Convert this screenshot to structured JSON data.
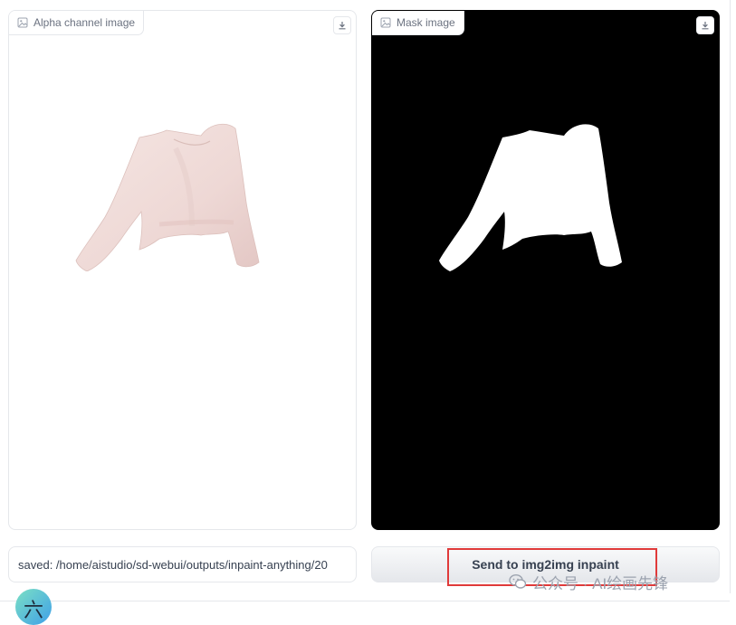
{
  "left_panel": {
    "label": "Alpha channel image",
    "icon": "image-icon",
    "download_icon": "download-icon"
  },
  "right_panel": {
    "label": "Mask image",
    "icon": "image-icon",
    "download_icon": "download-icon"
  },
  "status": {
    "text": "saved: /home/aistudio/sd-webui/outputs/inpaint-anything/20"
  },
  "send_button": {
    "label": "Send to img2img inpaint"
  },
  "watermark": {
    "text": "公众号 · AI绘画先锋",
    "icon": "wechat-icon"
  },
  "avatar": {
    "glyph": "六"
  },
  "colors": {
    "highlight": "#e03a3a",
    "garment": "#f1dedb",
    "mask_bg": "#000000",
    "mask_fg": "#ffffff"
  }
}
